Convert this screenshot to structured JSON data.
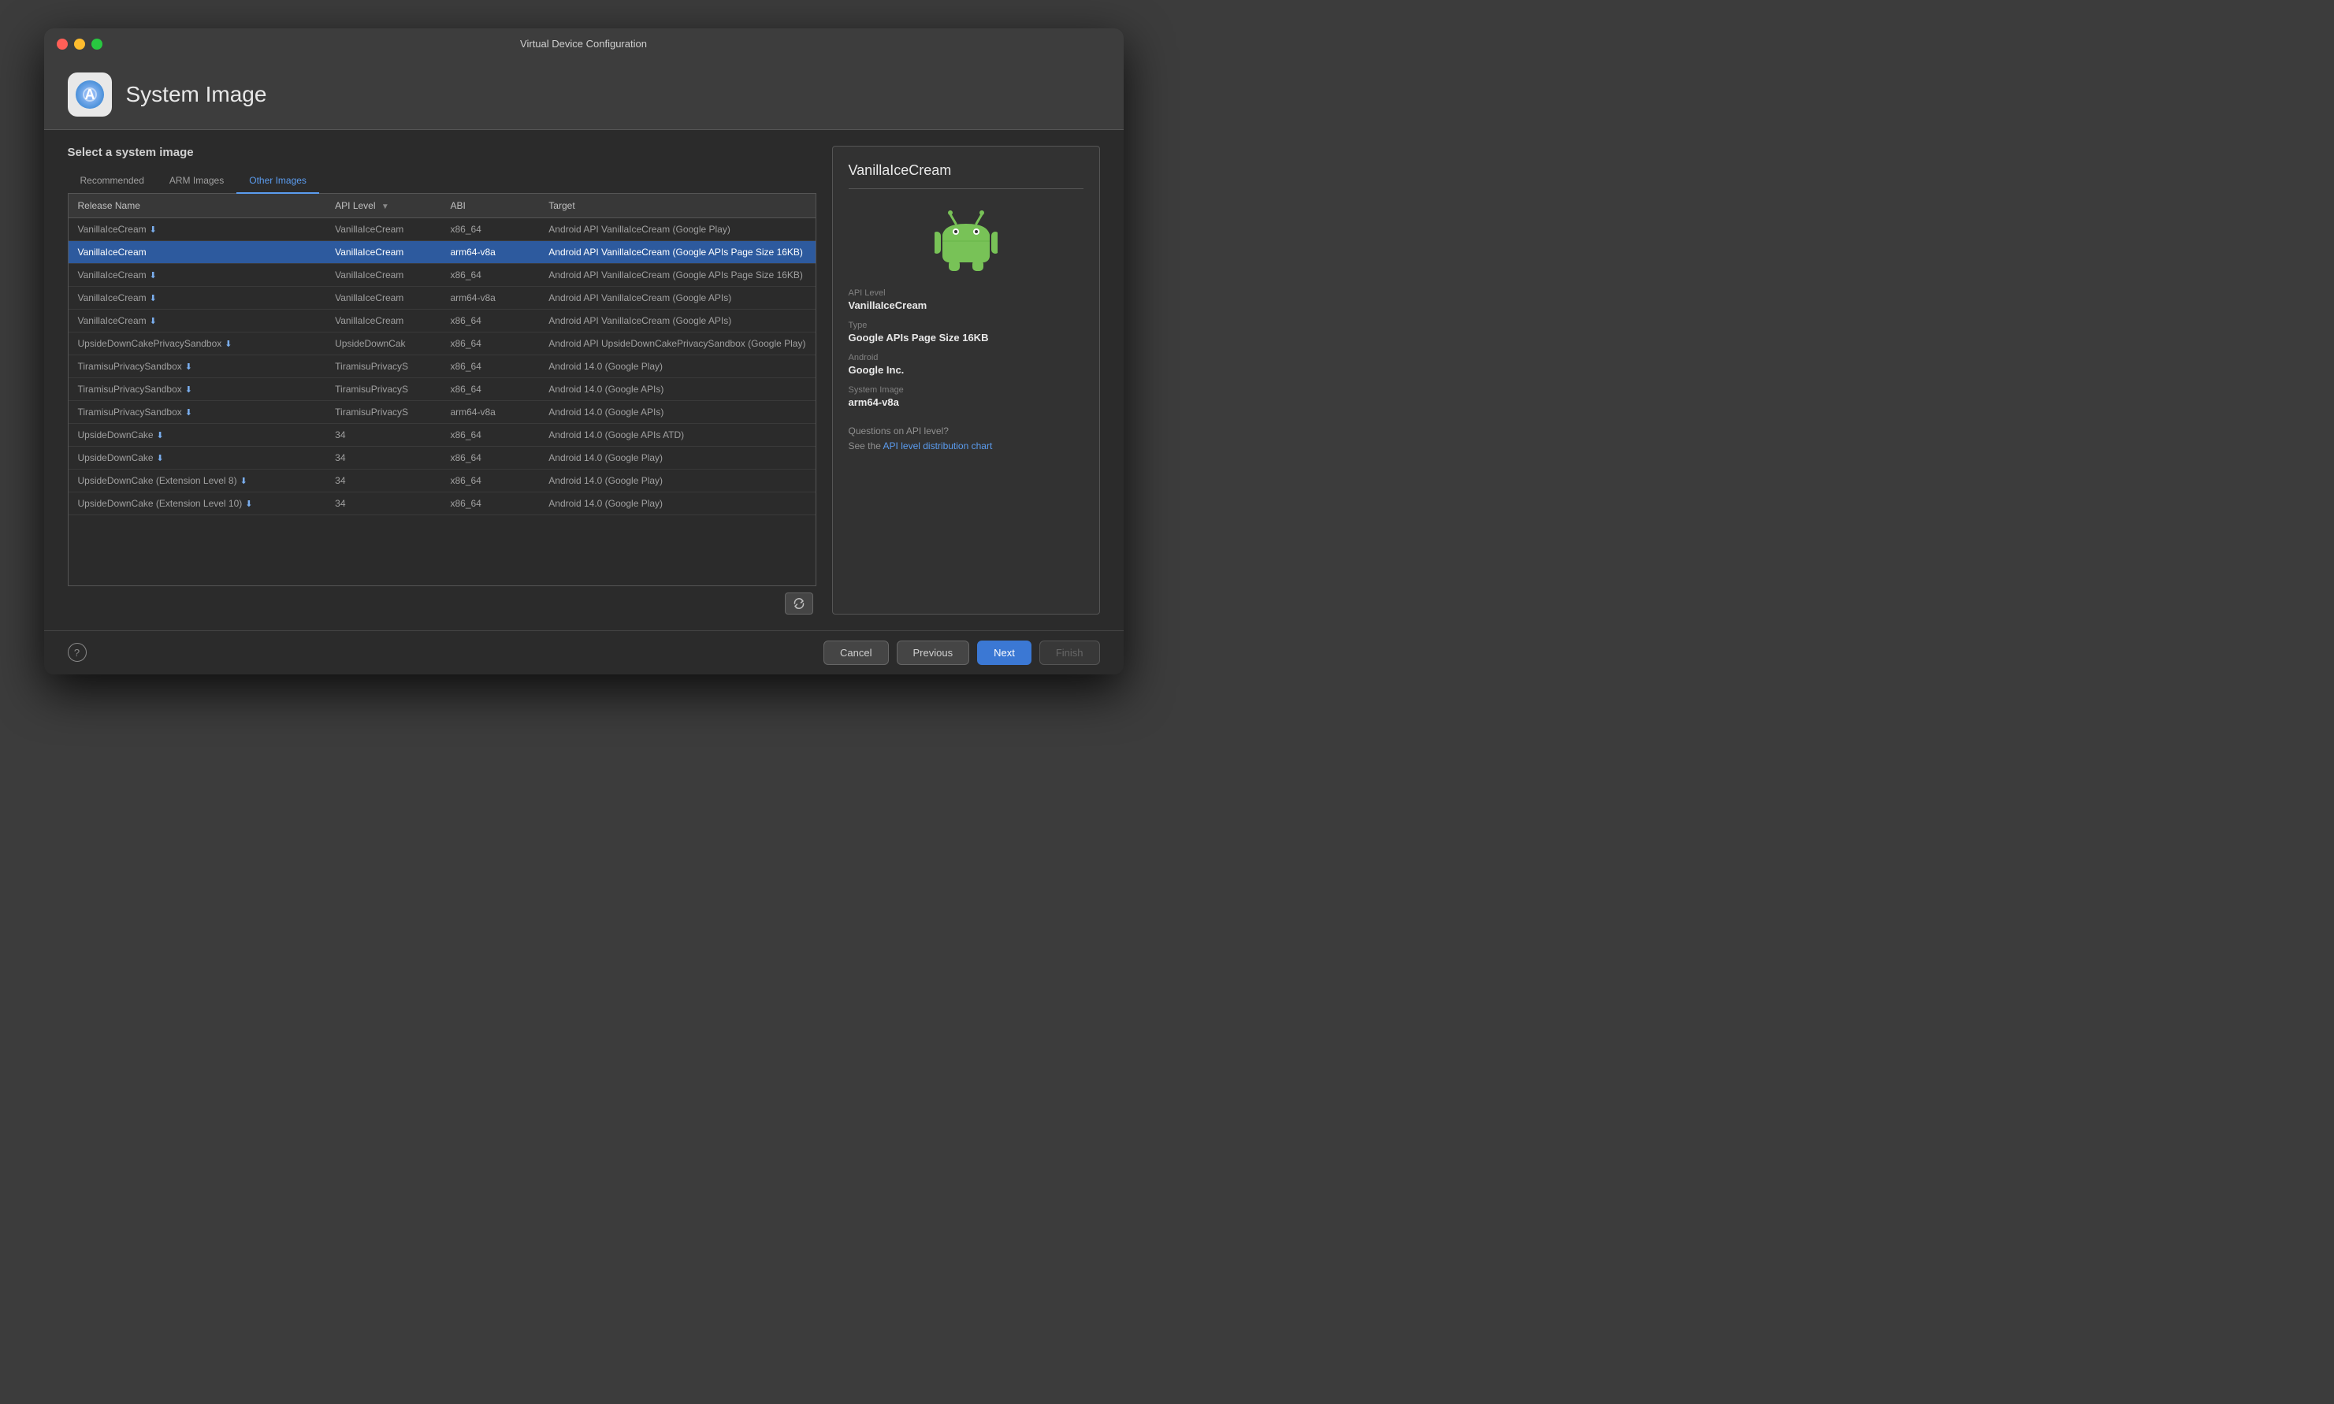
{
  "window": {
    "title": "Virtual Device Configuration"
  },
  "header": {
    "title": "System Image",
    "icon_label": "Android Studio"
  },
  "main": {
    "section_title": "Select a system image",
    "tabs": [
      {
        "id": "recommended",
        "label": "Recommended",
        "active": false
      },
      {
        "id": "arm-images",
        "label": "ARM Images",
        "active": false
      },
      {
        "id": "other-images",
        "label": "Other Images",
        "active": true
      }
    ],
    "table": {
      "columns": [
        {
          "id": "name",
          "label": "Release Name",
          "sortable": true
        },
        {
          "id": "api",
          "label": "API Level",
          "sortable": true
        },
        {
          "id": "abi",
          "label": "ABI",
          "sortable": false
        },
        {
          "id": "target",
          "label": "Target",
          "sortable": false
        }
      ],
      "rows": [
        {
          "name": "VanillaIceCream",
          "download": true,
          "api": "VanillaIceCream",
          "abi": "x86_64",
          "target": "Android API VanillaIceCream (Google Play)",
          "selected": false
        },
        {
          "name": "VanillaIceCream",
          "download": false,
          "api": "VanillaIceCream",
          "abi": "arm64-v8a",
          "target": "Android API VanillaIceCream (Google APIs Page Size 16KB)",
          "selected": true
        },
        {
          "name": "VanillaIceCream",
          "download": true,
          "api": "VanillaIceCream",
          "abi": "x86_64",
          "target": "Android API VanillaIceCream (Google APIs Page Size 16KB)",
          "selected": false
        },
        {
          "name": "VanillaIceCream",
          "download": true,
          "api": "VanillaIceCream",
          "abi": "arm64-v8a",
          "target": "Android API VanillaIceCream (Google APIs)",
          "selected": false
        },
        {
          "name": "VanillaIceCream",
          "download": true,
          "api": "VanillaIceCream",
          "abi": "x86_64",
          "target": "Android API VanillaIceCream (Google APIs)",
          "selected": false
        },
        {
          "name": "UpsideDownCakePrivacySandbox",
          "download": true,
          "api": "UpsideDownCak",
          "abi": "x86_64",
          "target": "Android API UpsideDownCakePrivacySandbox (Google Play)",
          "selected": false
        },
        {
          "name": "TiramisuPrivacySandbox",
          "download": true,
          "api": "TiramisuPrivacyS",
          "abi": "x86_64",
          "target": "Android 14.0 (Google Play)",
          "selected": false
        },
        {
          "name": "TiramisuPrivacySandbox",
          "download": true,
          "api": "TiramisuPrivacyS",
          "abi": "x86_64",
          "target": "Android 14.0 (Google APIs)",
          "selected": false
        },
        {
          "name": "TiramisuPrivacySandbox",
          "download": true,
          "api": "TiramisuPrivacyS",
          "abi": "arm64-v8a",
          "target": "Android 14.0 (Google APIs)",
          "selected": false
        },
        {
          "name": "UpsideDownCake",
          "download": true,
          "api": "34",
          "abi": "x86_64",
          "target": "Android 14.0 (Google APIs ATD)",
          "selected": false
        },
        {
          "name": "UpsideDownCake",
          "download": true,
          "api": "34",
          "abi": "x86_64",
          "target": "Android 14.0 (Google Play)",
          "selected": false
        },
        {
          "name": "UpsideDownCake (Extension Level 8)",
          "download": true,
          "api": "34",
          "abi": "x86_64",
          "target": "Android 14.0 (Google Play)",
          "selected": false
        },
        {
          "name": "UpsideDownCake (Extension Level 10)",
          "download": true,
          "api": "34",
          "abi": "x86_64",
          "target": "Android 14.0 (Google Play)",
          "selected": false
        }
      ]
    }
  },
  "detail": {
    "name": "VanillaIceCream",
    "api_level_label": "API Level",
    "api_level_value": "VanillaIceCream",
    "type_label": "Type",
    "type_value": "Google APIs Page Size 16KB",
    "android_label": "Android",
    "android_value": "Google Inc.",
    "system_image_label": "System Image",
    "system_image_value": "arm64-v8a",
    "api_help_text": "Questions on API level?",
    "api_see_text": "See the ",
    "api_link_text": "API level distribution chart"
  },
  "footer": {
    "help_icon": "?",
    "cancel_label": "Cancel",
    "previous_label": "Previous",
    "next_label": "Next",
    "finish_label": "Finish"
  },
  "colors": {
    "accent": "#3b78d4",
    "selected_row": "#2d5a9e",
    "link": "#5b9cef"
  }
}
